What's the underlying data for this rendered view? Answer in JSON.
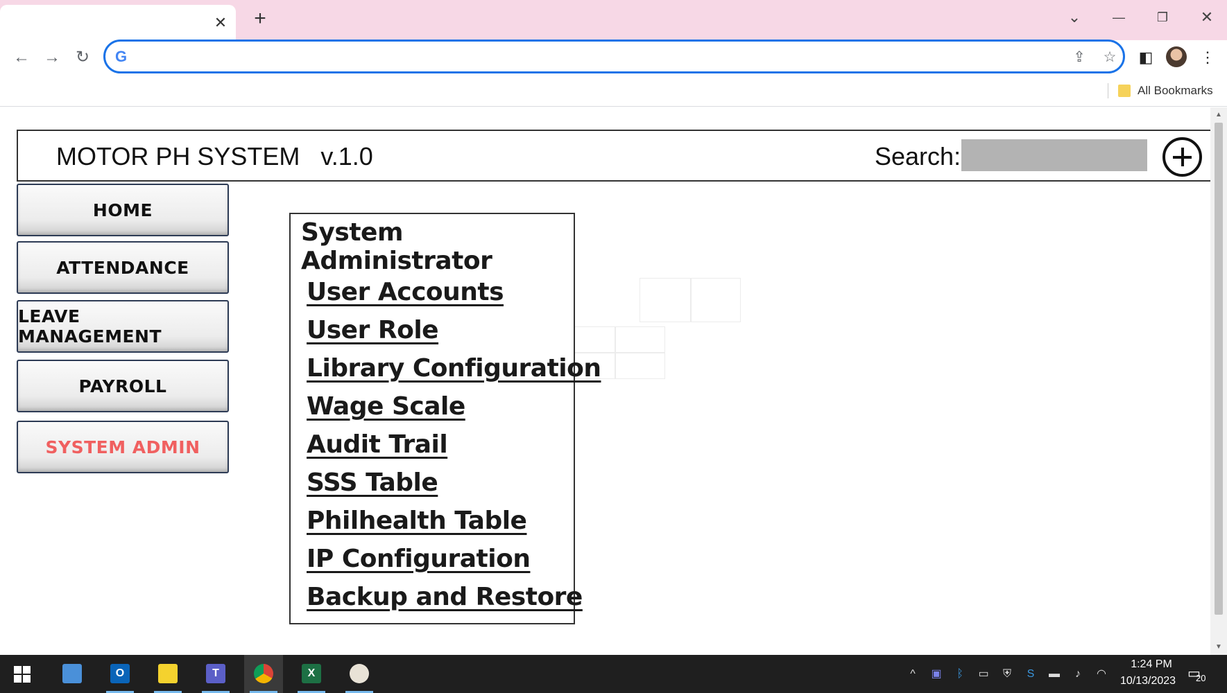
{
  "browser": {
    "tab_close": "✕",
    "new_tab": "+",
    "window_controls": {
      "tab_search": "⌄",
      "minimize": "—",
      "restore": "❐",
      "close": "✕"
    },
    "nav": {
      "back": "←",
      "forward": "→",
      "reload": "↻"
    },
    "omnibox": {
      "logo": "G",
      "value": "",
      "share_icon": "share-icon",
      "star_icon": "star-icon"
    },
    "bookmarks_label": "All Bookmarks"
  },
  "app": {
    "title": "MOTOR PH SYSTEM   v.1.0",
    "search_label": "Search:",
    "search_value": "",
    "add_icon": "plus-circle-icon"
  },
  "sidebar": {
    "items": [
      {
        "label": "HOME"
      },
      {
        "label": "ATTENDANCE"
      },
      {
        "label": "LEAVE MANAGEMENT"
      },
      {
        "label": "PAYROLL"
      },
      {
        "label": "SYSTEM ADMIN",
        "active": true
      }
    ],
    "active_color": "#f06060"
  },
  "admin_panel": {
    "title": "System Administrator",
    "links": [
      "User Accounts",
      "User Role",
      "Library Configuration",
      "Wage Scale",
      "Audit Trail",
      "SSS Table",
      "Philhealth Table",
      "IP Configuration",
      "Backup and Restore"
    ]
  },
  "taskbar": {
    "apps": [
      "windows-start",
      "file-explorer",
      "outlook",
      "sticky-notes",
      "teams",
      "chrome",
      "excel",
      "paint"
    ],
    "outlook_letter": "O",
    "teams_letter": "T",
    "excel_letter": "X",
    "time": "1:24 PM",
    "date": "10/13/2023",
    "notifications": "20"
  }
}
